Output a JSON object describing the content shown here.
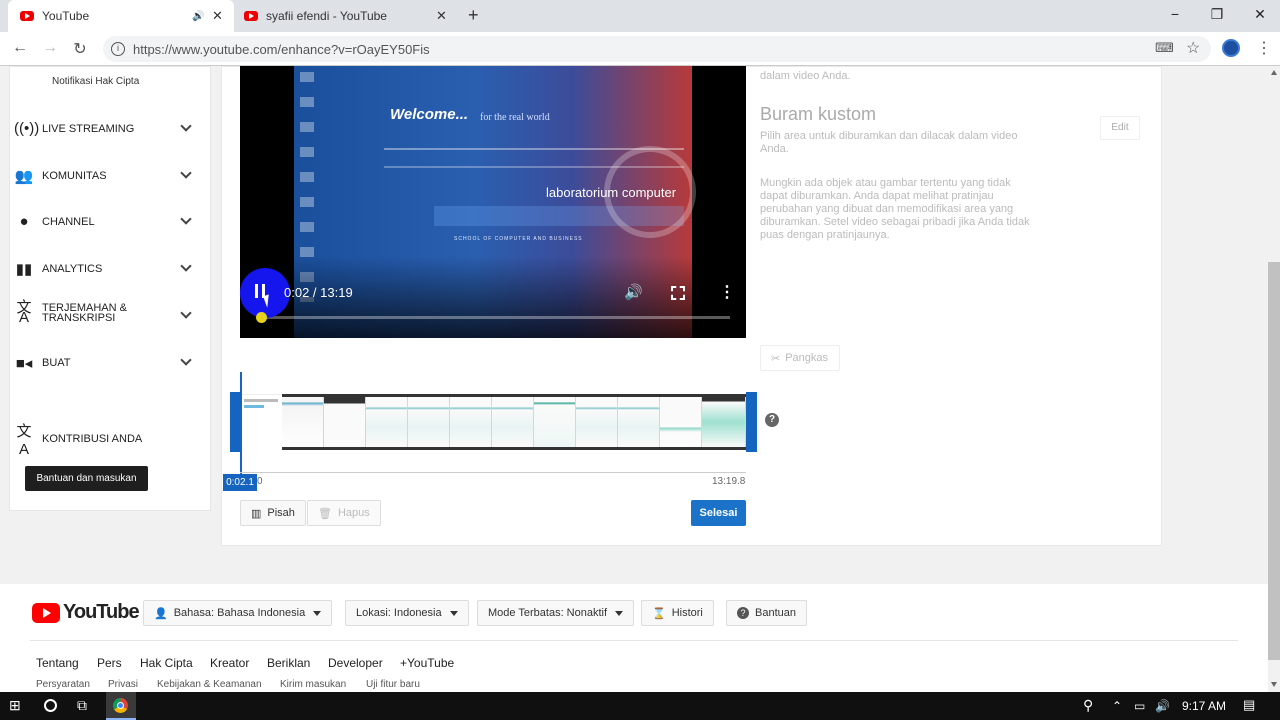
{
  "browser": {
    "tabs": [
      {
        "title": "YouTube",
        "active": true
      },
      {
        "title": "syafii efendi - YouTube",
        "active": false
      }
    ],
    "new_tab": "+",
    "url": "https://www.youtube.com/enhance?v=rOayEY50Fis",
    "window_controls": {
      "minimize": "−",
      "restore": "❐",
      "close": "✕"
    },
    "icons": [
      "back-icon",
      "forward-icon",
      "reload-icon",
      "info-icon",
      "translate-icon",
      "star-icon",
      "profile-icon",
      "menu-icon"
    ]
  },
  "sidebar": {
    "top_item": "Notifikasi Hak Cipta",
    "items": [
      {
        "label": "LIVE STREAMING",
        "icon": "live-icon"
      },
      {
        "label": "KOMUNITAS",
        "icon": "people-icon"
      },
      {
        "label": "CHANNEL",
        "icon": "account-icon"
      },
      {
        "label": "ANALYTICS",
        "icon": "chart-icon"
      },
      {
        "label": "TERJEMAHAN & TRANSKRIPSI",
        "icon": "translate-icon"
      },
      {
        "label": "BUAT",
        "icon": "camera-icon"
      }
    ],
    "kontribusi": "KONTRIBUSI ANDA",
    "help_button": "Bantuan dan masukan"
  },
  "video": {
    "time": "0:02 / 13:19",
    "progress": 0.003,
    "screen_text": {
      "welcome": "Welcome...",
      "tagline": "for the real world",
      "lab": "laboratorium computer",
      "school": "SCHOOL OF COMPUTER AND BUSINESS"
    }
  },
  "info": {
    "partial_text": "dalam video Anda.",
    "section_title": "Buram kustom",
    "section_desc": "Pilih area untuk diburamkan dan dilacak dalam video Anda.",
    "edit_button": "Edit",
    "note": "Mungkin ada objek atau gambar tertentu yang tidak dapat diburamkan. Anda dapat melihat pratinjau perubahan yang dibuat dan memodifikasi area yang diburamkan. Setel video sebagai pribadi jika Anda tidak puas dengan pratinjaunya.",
    "pangkas": "Pangkas"
  },
  "timeline": {
    "current_time": "0:02.1",
    "start_suffix": "0",
    "end_time": "13:19.8",
    "help": "?",
    "pisah": "Pisah",
    "hapus": "Hapus",
    "selesai": "Selesai"
  },
  "footer": {
    "logo_text": "YouTube",
    "bahasa": "Bahasa: Bahasa Indonesia",
    "lokasi": "Lokasi: Indonesia",
    "mode": "Mode Terbatas: Nonaktif",
    "histori": "Histori",
    "bantuan": "Bantuan",
    "links": [
      "Tentang",
      "Pers",
      "Hak Cipta",
      "Kreator",
      "Beriklan",
      "Developer",
      "+YouTube"
    ],
    "links2": [
      "Persyaratan",
      "Privasi",
      "Kebijakan & Keamanan",
      "Kirim masukan",
      "Uji fitur baru"
    ]
  },
  "taskbar": {
    "time": "9:17 AM"
  },
  "colors": {
    "accent": "#1565c0",
    "youtube_red": "#ff0000",
    "done_button": "#1a73c8"
  }
}
